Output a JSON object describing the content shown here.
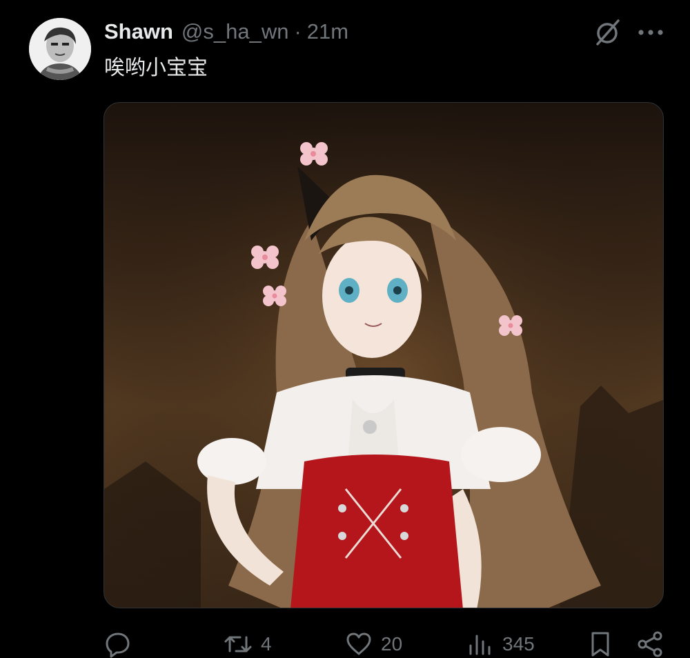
{
  "tweet": {
    "author_name": "Shawn",
    "handle": "@s_ha_wn",
    "separator": "·",
    "time": "21m",
    "text": "唉哟小宝宝"
  },
  "icons": {
    "avatar": "avatar",
    "grok": "grok-icon",
    "more": "more-icon"
  },
  "actions": {
    "reply": {
      "icon": "reply-icon",
      "count": ""
    },
    "retweet": {
      "icon": "retweet-icon",
      "count": "4"
    },
    "like": {
      "icon": "heart-icon",
      "count": "20"
    },
    "views": {
      "icon": "views-icon",
      "count": "345"
    },
    "bookmark": {
      "icon": "bookmark-icon"
    },
    "share": {
      "icon": "share-icon"
    }
  },
  "colors": {
    "background": "#000000",
    "text_primary": "#e7e9ea",
    "text_secondary": "#71767b",
    "icon": "#71767b",
    "media_border": "#2f3336"
  }
}
